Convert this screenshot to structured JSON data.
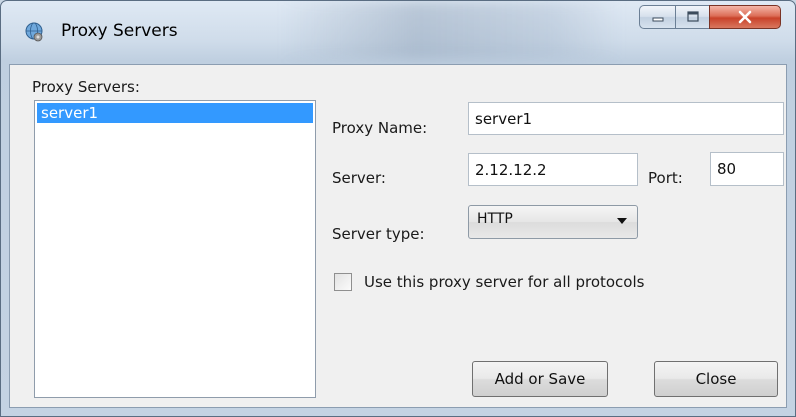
{
  "window": {
    "title": "Proxy Servers",
    "icon": "globe-gear-icon"
  },
  "caption_buttons": {
    "minimize_icon": "minimize-icon",
    "maximize_icon": "maximize-icon",
    "close_icon": "close-icon"
  },
  "list": {
    "label": "Proxy Servers:",
    "items": [
      "server1"
    ],
    "selected_index": 0
  },
  "form": {
    "proxy_name_label": "Proxy Name:",
    "proxy_name_value": "server1",
    "server_label": "Server:",
    "server_value": "2.12.12.2",
    "port_label": "Port:",
    "port_value": "80",
    "server_type_label": "Server type:",
    "server_type_value": "HTTP",
    "use_all_label": "Use this proxy server for all protocols",
    "use_all_checked": false
  },
  "buttons": {
    "add_save": "Add or Save",
    "close": "Close"
  },
  "colors": {
    "selection": "#3399ff",
    "close_button": "#c9422a",
    "client_bg": "#f0f0f0"
  }
}
